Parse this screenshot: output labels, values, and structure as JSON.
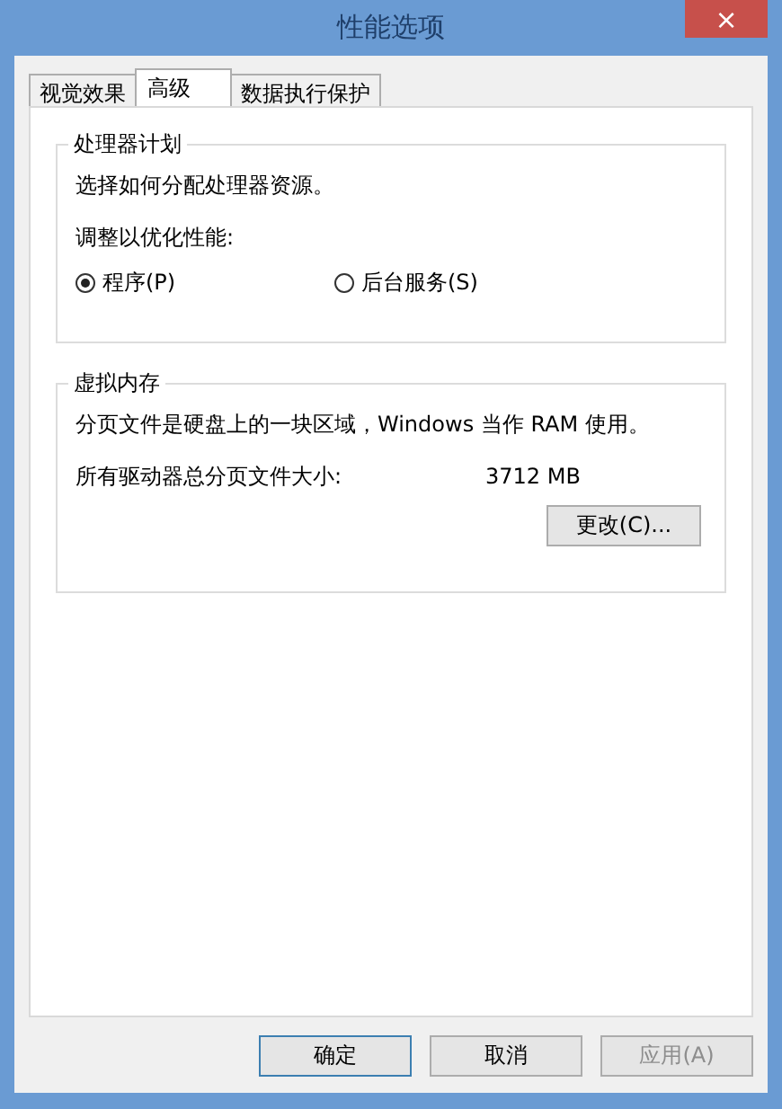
{
  "window": {
    "title": "性能选项",
    "close": "×"
  },
  "tabs": [
    {
      "label": "视觉效果",
      "selected": false
    },
    {
      "label": "高级",
      "selected": true
    },
    {
      "label": "数据执行保护",
      "selected": false
    }
  ],
  "processor_scheduling": {
    "title": "处理器计划",
    "description": "选择如何分配处理器资源。",
    "adjust_label": "调整以优化性能:",
    "options": [
      {
        "label": "程序(P)",
        "selected": true
      },
      {
        "label": "后台服务(S)",
        "selected": false
      }
    ]
  },
  "virtual_memory": {
    "title": "虚拟内存",
    "description": "分页文件是硬盘上的一块区域，Windows 当作 RAM 使用。",
    "total_label": "所有驱动器总分页文件大小:",
    "total_value": "3712 MB",
    "change_button": "更改(C)..."
  },
  "buttons": [
    {
      "label": "确定",
      "disabled": false,
      "default": true
    },
    {
      "label": "取消",
      "disabled": false,
      "default": false
    },
    {
      "label": "应用(A)",
      "disabled": true,
      "default": false
    }
  ]
}
